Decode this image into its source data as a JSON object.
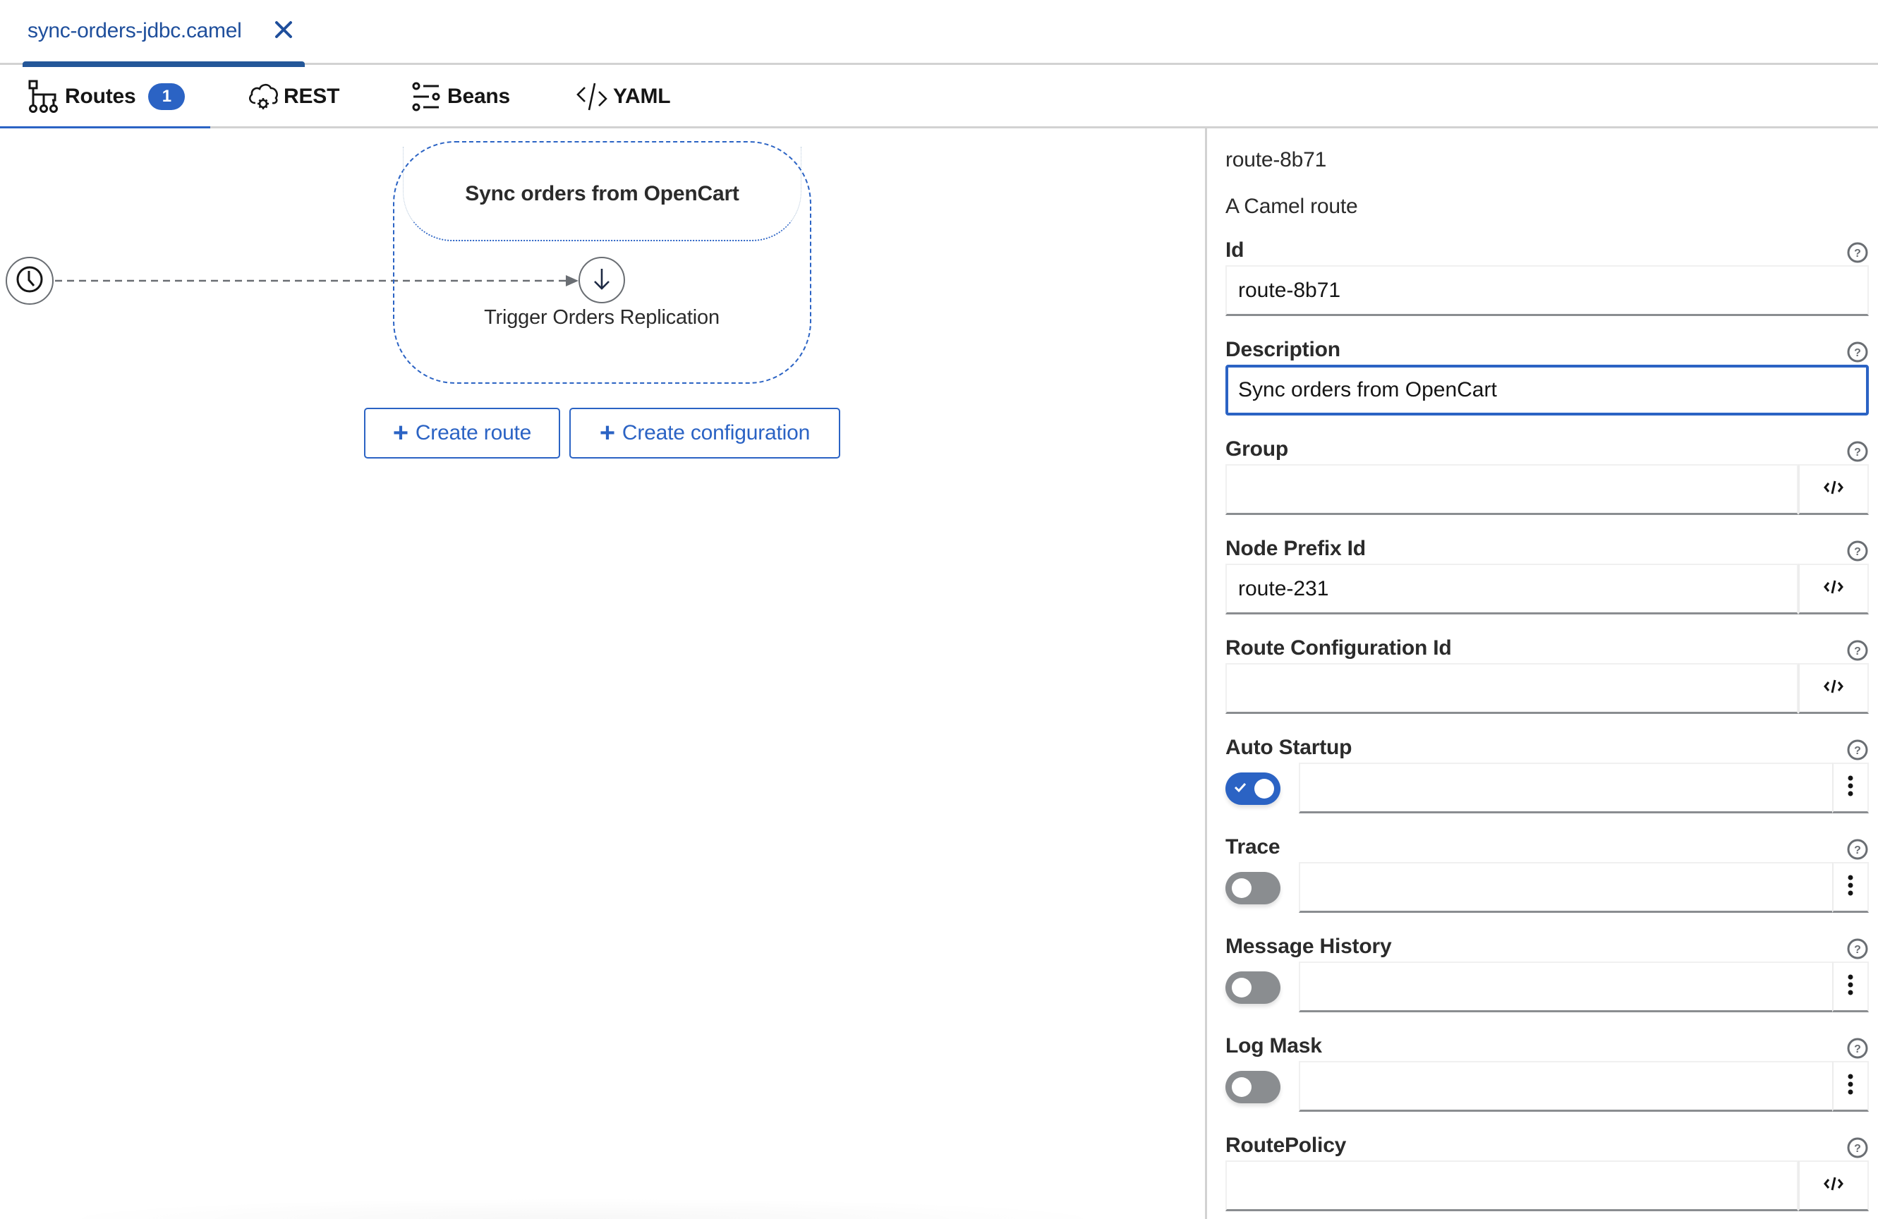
{
  "file_tab": {
    "label": "sync-orders-jdbc.camel",
    "close_icon": "close-icon"
  },
  "view_tabs": [
    {
      "label": "Routes",
      "icon": "routes-icon",
      "badge": "1",
      "active": true
    },
    {
      "label": "REST",
      "icon": "cloud-gear-icon",
      "active": false
    },
    {
      "label": "Beans",
      "icon": "beans-sliders-icon",
      "active": false
    },
    {
      "label": "YAML",
      "icon": "code-icon",
      "active": false
    }
  ],
  "canvas": {
    "route": {
      "title": "Sync orders from OpenCart",
      "start_icon": "clock-icon",
      "step": {
        "label": "Trigger Orders Replication",
        "icon": "arrow-down-icon"
      }
    },
    "buttons": {
      "create_route": "Create route",
      "create_configuration": "Create configuration"
    }
  },
  "panel": {
    "title": "route-8b71",
    "subtitle": "A Camel route",
    "fields": {
      "id": {
        "label": "Id",
        "value": "route-8b71"
      },
      "description": {
        "label": "Description",
        "value": "Sync orders from OpenCart"
      },
      "group": {
        "label": "Group",
        "value": ""
      },
      "node_prefix_id": {
        "label": "Node Prefix Id",
        "value": "route-231"
      },
      "route_configuration_id": {
        "label": "Route Configuration Id",
        "value": ""
      },
      "auto_startup": {
        "label": "Auto Startup",
        "checked": true,
        "value": ""
      },
      "trace": {
        "label": "Trace",
        "checked": false,
        "value": ""
      },
      "message_history": {
        "label": "Message History",
        "checked": false,
        "value": ""
      },
      "log_mask": {
        "label": "Log Mask",
        "checked": false,
        "value": ""
      },
      "route_policy": {
        "label": "RoutePolicy",
        "value": ""
      }
    }
  },
  "colors": {
    "accent": "#2b63c4",
    "file_tab_text": "#1f4f9c",
    "toggle_off": "#8a8d90",
    "node_border": "#6a6e73"
  }
}
